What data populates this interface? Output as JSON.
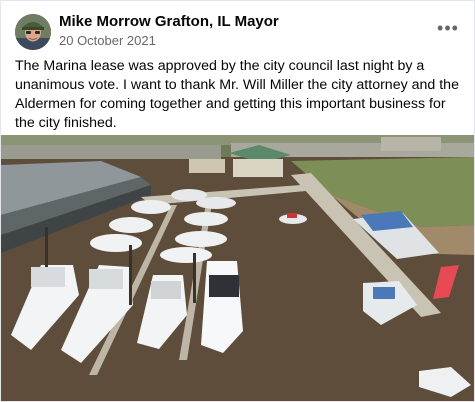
{
  "post": {
    "author": "Mike Morrow Grafton, IL Mayor",
    "date": "20 October 2021",
    "more_icon": "more-horizontal-icon",
    "body": "The Marina lease was approved by the city council last night by a unanimous vote. I want to thank Mr. Will Miller the city attorney and the Aldermen for coming together and getting this important business for the city finished."
  },
  "photo": {
    "subject": "aerial view of a marina with docked boats",
    "colors": {
      "water": "#5d4d3a",
      "dock": "#c9c3b4",
      "roof": "#8f979a",
      "grass": "#7d8f57"
    }
  }
}
